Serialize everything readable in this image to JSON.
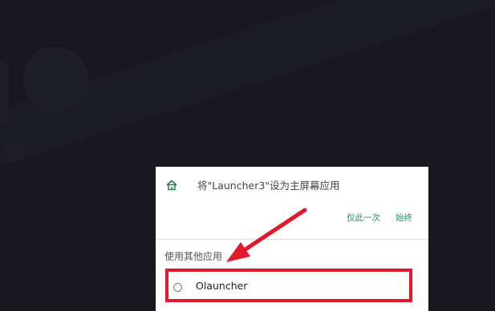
{
  "dialog": {
    "title": "将\"Launcher3\"设为主屏幕应用",
    "title_icon": "home-icon",
    "actions": {
      "once": "仅此一次",
      "always": "始终"
    },
    "section_label": "使用其他应用",
    "options": [
      {
        "label": "Olauncher",
        "selected": false
      }
    ]
  },
  "annotation": {
    "highlight_color": "#e2192c",
    "arrow_color": "#e2192c"
  },
  "colors": {
    "accent": "#2a8d64",
    "background": "#17171d"
  }
}
